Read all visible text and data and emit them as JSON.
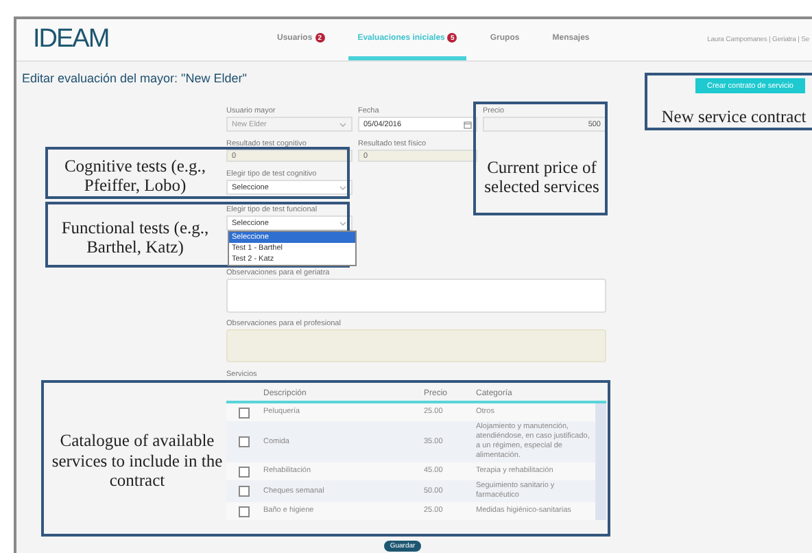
{
  "header": {
    "logo": "IDEAM",
    "nav": [
      {
        "label": "Usuarios",
        "badge": "2",
        "selected": false
      },
      {
        "label": "Evaluaciones iniciales",
        "badge": "5",
        "selected": true
      },
      {
        "label": "Grupos",
        "selected": false
      },
      {
        "label": "Mensajes",
        "selected": false
      }
    ],
    "user": "Laura Campomanes | Geriatra | Se"
  },
  "page_title": "Editar evaluación del mayor: \"New Elder\"",
  "create_contract_button": "Crear contrato de servicio",
  "form": {
    "elder": {
      "label": "Usuario mayor",
      "value": "New Elder",
      "disabled": true
    },
    "date": {
      "label": "Fecha",
      "value": "05/04/2016"
    },
    "price": {
      "label": "Precio",
      "value": "500"
    },
    "cognitive_result": {
      "label": "Resultado test cognitivo",
      "value": "0"
    },
    "physical_result": {
      "label": "Resultado test físico",
      "value": "0"
    },
    "cognitive_test": {
      "label": "Elegir tipo de test cognitivo",
      "value": "Seleccione"
    },
    "functional_test": {
      "label": "Elegir tipo de test funcional",
      "value": "Seleccione",
      "expanded": true,
      "options": [
        {
          "label": "Seleccione",
          "selected": true
        },
        {
          "label": "Test 1 - Barthel",
          "selected": false
        },
        {
          "label": "Test 2 - Katz",
          "selected": false
        }
      ]
    },
    "notes_elder": {
      "label": "Observaciones para el geriatra"
    },
    "notes_professional": {
      "label": "Observaciones para el profesional"
    },
    "services_label": "Servicios"
  },
  "services": {
    "columns": [
      "Descripción",
      "Precio",
      "Categoría"
    ],
    "rows": [
      {
        "description": "Peluquería",
        "price": "25.00",
        "category": "Otros",
        "checked": false
      },
      {
        "description": "Comida",
        "price": "35.00",
        "category": "Alojamiento y manutención, atendiéndose, en caso justificado, a un régimen, especial de alimentación.",
        "checked": false
      },
      {
        "description": "Rehabilitación",
        "price": "45.00",
        "category": "Terapia y rehabilitación",
        "checked": false
      },
      {
        "description": "Cheques semanal",
        "price": "50.00",
        "category": "Seguimiento sanitario y farmacéutico",
        "checked": false
      },
      {
        "description": "Baño e higiene",
        "price": "25.00",
        "category": "Medidas higiénico-sanitarias",
        "checked": false
      }
    ]
  },
  "save_button": "Guardar",
  "annotations": {
    "cognitive_tests": "Cognitive tests (e.g., Pfeiffer, Lobo)",
    "functional_tests": "Functional tests (e.g., Barthel, Katz)",
    "current_price": "Current price of selected services",
    "new_service_contract": "New service contract",
    "services_catalogue": "Catalogue of available services to include in the contract"
  }
}
